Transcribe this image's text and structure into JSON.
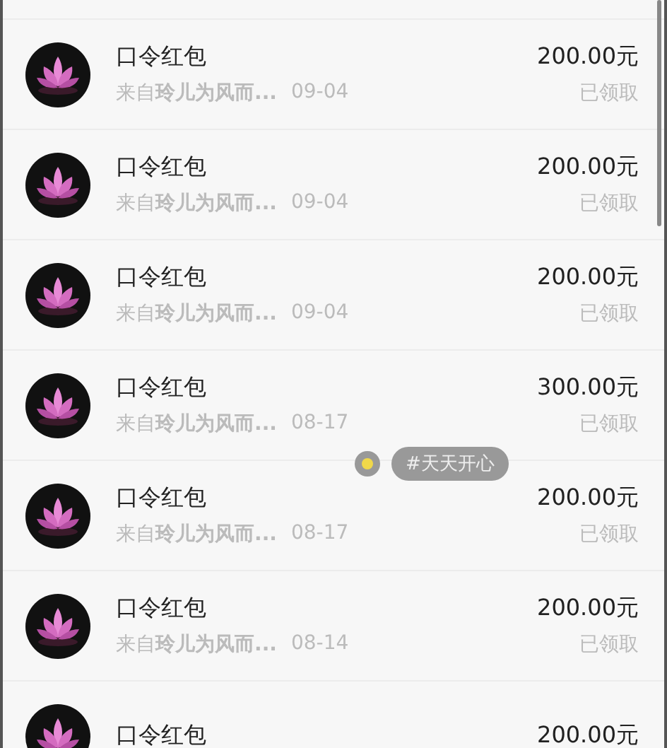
{
  "records": [
    {
      "title": "口令红包",
      "sender": "来自**玲儿为风而...**",
      "date": "09-04",
      "amount": "200.00元",
      "status": "已领取"
    },
    {
      "title": "口令红包",
      "sender": "来自**玲儿为风而...**",
      "date": "09-04",
      "amount": "200.00元",
      "status": "已领取"
    },
    {
      "title": "口令红包",
      "sender": "来自**玲儿为风而...**",
      "date": "09-04",
      "amount": "200.00元",
      "status": "已领取"
    },
    {
      "title": "口令红包",
      "sender": "来自**玲儿为风而...**",
      "date": "08-17",
      "amount": "300.00元",
      "status": "已领取"
    },
    {
      "title": "口令红包",
      "sender": "来自**玲儿为风而...**",
      "date": "08-17",
      "amount": "200.00元",
      "status": "已领取"
    },
    {
      "title": "口令红包",
      "sender": "来自**玲儿为风而...**",
      "date": "08-14",
      "amount": "200.00元",
      "status": "已领取"
    },
    {
      "title": "口令红包",
      "amount": "200.00元"
    }
  ],
  "tag": {
    "label": "#天天开心"
  }
}
